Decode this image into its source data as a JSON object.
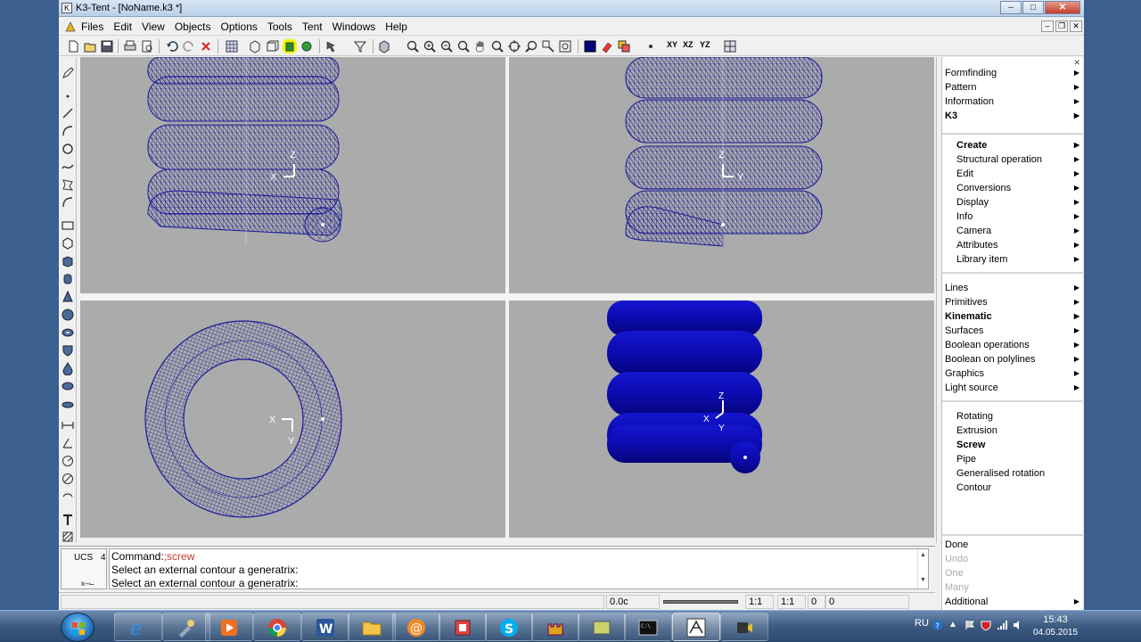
{
  "window": {
    "title": "K3-Tent - [NoName.k3 *]"
  },
  "menubar": {
    "items": [
      "Files",
      "Edit",
      "View",
      "Objects",
      "Options",
      "Tools",
      "Tent",
      "Windows",
      "Help"
    ]
  },
  "toolbar": {
    "xy": "XY",
    "xz": "XZ",
    "yz": "YZ"
  },
  "viewports": {
    "top_left": {
      "axis_x": "X",
      "axis_z": "Z"
    },
    "top_right": {
      "axis_y": "Y",
      "axis_z": "Z"
    },
    "bottom_left": {
      "axis_x": "X",
      "axis_y": "Y"
    },
    "bottom_right": {
      "axis_z": "Z",
      "axis_x": "X",
      "axis_y": "Y"
    },
    "mesh_color": "#1a1a9a",
    "solid_color": "#0b0bb0",
    "background": "#ababab"
  },
  "right_panel": {
    "group1": [
      "Formfinding",
      "Pattern",
      "Information",
      "K3"
    ],
    "group2": [
      "Create",
      "Structural operation",
      "Edit",
      "Conversions",
      "Display",
      "Info",
      "Camera",
      "Attributes",
      "Library item"
    ],
    "group3": [
      "Lines",
      "Primitives",
      "Kinematic",
      "Surfaces",
      "Boolean operations",
      "Boolean on polylines",
      "Graphics",
      "Light source"
    ],
    "group4": [
      "Rotating",
      "Extrusion",
      "Screw",
      "Pipe",
      "Generalised rotation",
      "Contour"
    ],
    "group5": [
      "Done",
      "Undo",
      "One",
      "Many",
      "Additional"
    ]
  },
  "command": {
    "ucs_label": "UCS",
    "ucs_num": "4",
    "prefix": "Command:",
    "command_name": ";screw",
    "line2": "Select an external contour a generatrix:",
    "line3": "Select an external contour a generatrix:"
  },
  "status": {
    "coord": "0.0c",
    "scale1": "1:1",
    "scale2": "1:1",
    "val1": "0",
    "val2": "0"
  },
  "taskbar": {
    "lang": "RU",
    "time": "15:43",
    "date": "04.05.2015"
  }
}
